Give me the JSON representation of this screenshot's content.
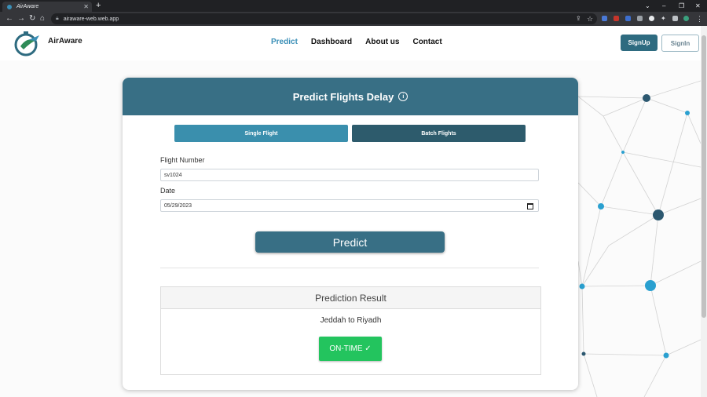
{
  "browser": {
    "tab_title": "AirAware",
    "tab_close": "✕",
    "new_tab": "+",
    "url": "airaware-web.web.app",
    "window_controls": [
      "⌄",
      "–",
      "❐",
      "✕"
    ]
  },
  "site": {
    "logo_text": "AirAware",
    "nav": [
      "Predict",
      "Dashboard",
      "About us",
      "Contact"
    ],
    "active_nav": "Predict",
    "signup_label": "SignUp",
    "signin_label": "SignIn"
  },
  "card": {
    "title": "Predict Flights Delay",
    "info_icon": "info-circle-icon",
    "tab_single": "Single Flight",
    "tab_batch": "Batch Flights",
    "flight_number_label": "Flight Number",
    "flight_number_value": "sv1024",
    "date_label": "Date",
    "date_value": "05/29/2023",
    "predict_label": "Predict"
  },
  "result": {
    "heading": "Prediction Result",
    "route": "Jeddah to Riyadh",
    "status": "ON-TIME ✓"
  },
  "colors": {
    "accent": "#386f85",
    "tab_active": "#3a8fad",
    "tab_dark": "#2d5b6c",
    "success": "#23c45e",
    "nav_active": "#3a8fb7"
  }
}
